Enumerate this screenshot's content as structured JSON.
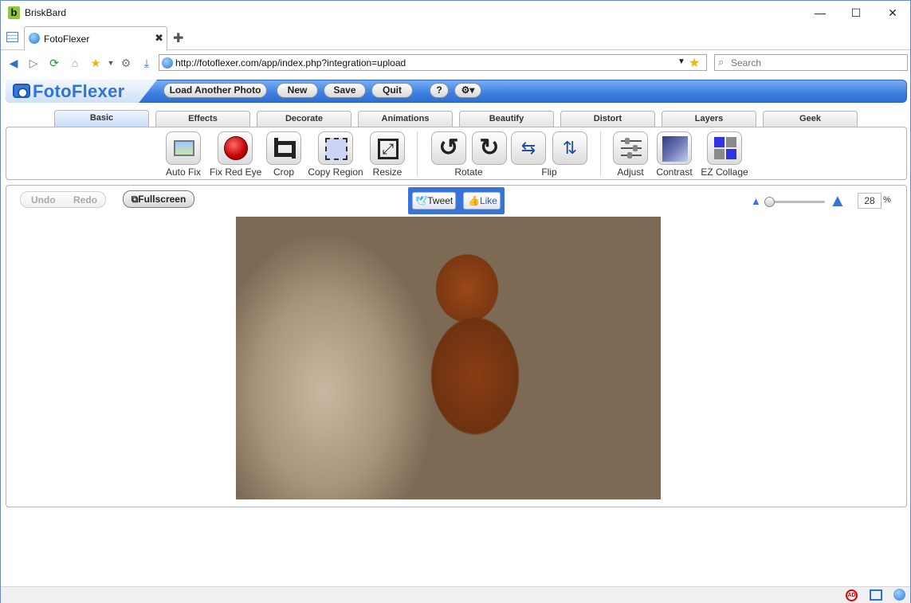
{
  "window": {
    "title": "BriskBard",
    "logo_letter": "b",
    "minimize": "—",
    "maximize": "☐",
    "close": "✕"
  },
  "browser": {
    "tab": {
      "label": "FotoFlexer",
      "close": "✖"
    },
    "new_tab": "✚",
    "url": "http://fotoflexer.com/app/index.php?integration=upload",
    "search_placeholder": "Search"
  },
  "app": {
    "logo": "FotoFlexer",
    "toolbar": {
      "load_label": "Load Another Photo",
      "new_label": "New",
      "save_label": "Save",
      "quit_label": "Quit",
      "help_label": "?",
      "settings_label": "⚙▾"
    },
    "tabs": [
      "Basic",
      "Effects",
      "Decorate",
      "Animations",
      "Beautify",
      "Distort",
      "Layers",
      "Geek"
    ],
    "active_tab": "Basic",
    "tools": [
      "Auto Fix",
      "Fix Red Eye",
      "Crop",
      "Copy Region",
      "Resize",
      "Rotate",
      "Flip",
      "Adjust",
      "Contrast",
      "EZ Collage"
    ],
    "workspace": {
      "undo_label": "Undo",
      "redo_label": "Redo",
      "fullscreen_label": "Fullscreen",
      "tweet_label": "Tweet",
      "like_label": "Like",
      "zoom_value": "28",
      "zoom_unit": "%"
    }
  },
  "colors": {
    "accent": "#3d7fe0",
    "social_bg": "#3a73d6"
  }
}
